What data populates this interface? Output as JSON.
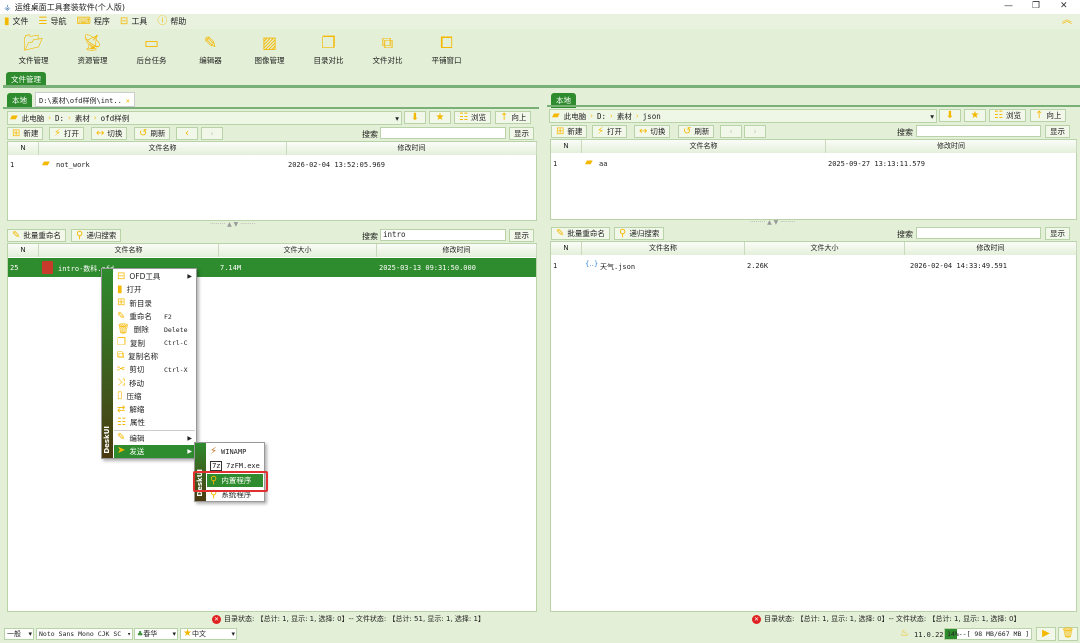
{
  "title": "运维桌面工具套装软件(个人版)",
  "menu": [
    {
      "icon": "file-icon",
      "label": "文件"
    },
    {
      "icon": "list-icon",
      "label": "导航"
    },
    {
      "icon": "keyboard-icon",
      "label": "程序"
    },
    {
      "icon": "toolbox-icon",
      "label": "工具"
    },
    {
      "icon": "help-icon",
      "label": "帮助"
    }
  ],
  "toolbar": [
    {
      "icon": "folder-open-icon",
      "label": "文件管理"
    },
    {
      "icon": "satellite-icon",
      "label": "资源管理"
    },
    {
      "icon": "monitor-icon",
      "label": "后台任务"
    },
    {
      "icon": "edit-icon",
      "label": "编辑器"
    },
    {
      "icon": "image-icon",
      "label": "图像管理"
    },
    {
      "icon": "copy-icon",
      "label": "目录对比"
    },
    {
      "icon": "compare-icon",
      "label": "文件对比"
    },
    {
      "icon": "windows-icon",
      "label": "平铺窗口"
    }
  ],
  "main_tab": "文件管理",
  "left": {
    "tabs": [
      "本地",
      "D:\\素材\\ofd样例\\int.."
    ],
    "path": [
      "此电脑",
      "D:",
      "素材",
      "ofd样例"
    ],
    "buttons": {
      "browse": "浏览",
      "up": "向上",
      "new": "新建",
      "open": "打开",
      "switch": "切换",
      "refresh": "刷新",
      "search_label": "搜索",
      "show": "显示",
      "batch_rename": "批量重命名",
      "recursive_search": "递归搜索"
    },
    "dir_search": "",
    "dir_headers": [
      "N",
      "文件名称",
      "修改时间"
    ],
    "dirs": [
      {
        "n": "1",
        "name": "not_work",
        "time": "2026-02-04 13:52:05.969"
      }
    ],
    "file_search": "intro",
    "file_headers": [
      "N",
      "文件名称",
      "文件大小",
      "修改时间"
    ],
    "files": [
      {
        "n": "25",
        "name": "intro-数科.ofd",
        "size": "7.14M",
        "time": "2025-03-13 09:31:50.000",
        "selected": true
      }
    ],
    "status": "目录状态: 【总计: 1, 显示: 1, 选择: 0】-- 文件状态: 【总计: 51, 显示: 1, 选择: 1】"
  },
  "right": {
    "tabs": [
      "本地"
    ],
    "path": [
      "此电脑",
      "D:",
      "素材",
      "json"
    ],
    "dir_search": "",
    "dirs": [
      {
        "n": "1",
        "name": "aa",
        "time": "2025-09-27 13:13:11.579"
      }
    ],
    "file_search": "",
    "files": [
      {
        "n": "1",
        "name": "天气.json",
        "size": "2.26K",
        "time": "2026-02-04 14:33:49.591"
      }
    ],
    "status": "目录状态: 【总计: 1, 显示: 1, 选择: 0】-- 文件状态: 【总计: 1, 显示: 1, 选择: 0】"
  },
  "context_menu": {
    "brand": "DeskUI",
    "items": [
      {
        "label": "OFD工具",
        "submenu": true
      },
      {
        "label": "打开"
      },
      {
        "label": "新目录"
      },
      {
        "label": "重命名",
        "shortcut": "F2"
      },
      {
        "label": "删除",
        "shortcut": "Delete"
      },
      {
        "label": "复制",
        "shortcut": "Ctrl-C"
      },
      {
        "label": "复制名称"
      },
      {
        "label": "剪切",
        "shortcut": "Ctrl-X"
      },
      {
        "label": "移动"
      },
      {
        "label": "压缩"
      },
      {
        "label": "解缩"
      },
      {
        "label": "属性"
      },
      {
        "label": "编辑",
        "submenu": true
      },
      {
        "label": "发送",
        "submenu": true
      }
    ],
    "submenu": [
      {
        "label": "WINAMP"
      },
      {
        "label": "7zFM.exe"
      },
      {
        "label": "内置程序",
        "highlighted": true
      },
      {
        "label": "系统程序"
      }
    ]
  },
  "bottom": {
    "level": "一般",
    "font": "Noto Sans Mono CJK SC",
    "theme": "春华",
    "lang": "中文",
    "version": "11.0.22",
    "memory": "14%--[ 98 MB/667 MB ]",
    "memory_percent": 14
  },
  "colors": {
    "accent": "#2e8b2e",
    "icon": "#f5b800",
    "highlight_border": "#e03030"
  }
}
